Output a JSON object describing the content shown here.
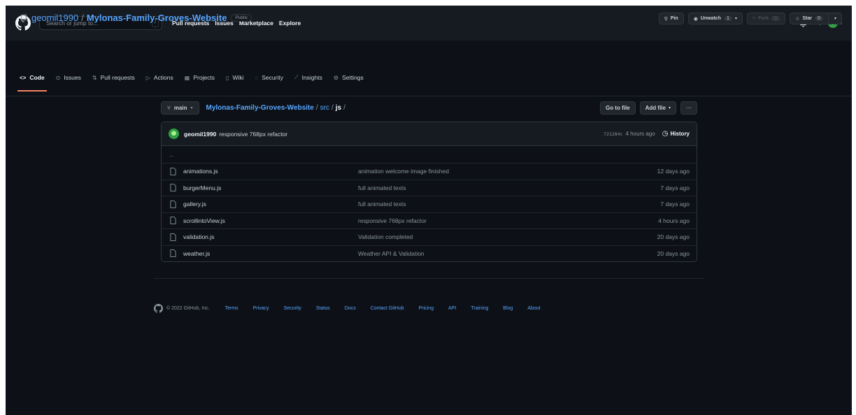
{
  "header": {
    "search_placeholder": "Search or jump to...",
    "search_shortcut": "/",
    "nav": [
      "Pull requests",
      "Issues",
      "Marketplace",
      "Explore"
    ],
    "plus_label": "+",
    "caret": "▾"
  },
  "repo": {
    "owner": "geomil1990",
    "name": "Mylonas-Family-Groves-Website",
    "visibility": "Public",
    "actions": {
      "pin": "Pin",
      "unwatch": "Unwatch",
      "unwatch_count": "1",
      "fork": "Fork",
      "fork_count": "0",
      "star": "Star",
      "star_count": "0"
    },
    "tabs": [
      {
        "label": "Code",
        "icon": "<>"
      },
      {
        "label": "Issues",
        "icon": "⊙"
      },
      {
        "label": "Pull requests",
        "icon": "⇅"
      },
      {
        "label": "Actions",
        "icon": "▷"
      },
      {
        "label": "Projects",
        "icon": "▦"
      },
      {
        "label": "Wiki",
        "icon": "▯"
      },
      {
        "label": "Security",
        "icon": "◌"
      },
      {
        "label": "Insights",
        "icon": "⟋"
      },
      {
        "label": "Settings",
        "icon": "⚙"
      }
    ]
  },
  "path": {
    "branch": "main",
    "root": "Mylonas-Family-Groves-Website",
    "segments": [
      "src"
    ],
    "current": "js",
    "go_to_file": "Go to file",
    "add_file": "Add file",
    "more": "···"
  },
  "commit": {
    "author": "geomil1990",
    "message": "responsive 768px refactor",
    "sha": "721284c",
    "age": "4 hours ago",
    "history": "History"
  },
  "parent_dir": "..",
  "files": [
    {
      "name": "animations.js",
      "message": "animation welcome image finished",
      "age": "12 days ago"
    },
    {
      "name": "burgerMenu.js",
      "message": "full animated texts",
      "age": "7 days ago"
    },
    {
      "name": "gallery.js",
      "message": "full animated texts",
      "age": "7 days ago"
    },
    {
      "name": "scrollintoView.js",
      "message": "responsive 768px refactor",
      "age": "4 hours ago"
    },
    {
      "name": "validation.js",
      "message": "Validation completed",
      "age": "20 days ago"
    },
    {
      "name": "weather.js",
      "message": "Weather API & Validation",
      "age": "20 days ago"
    }
  ],
  "footer": {
    "copyright": "© 2022 GitHub, Inc.",
    "links": [
      "Terms",
      "Privacy",
      "Security",
      "Status",
      "Docs",
      "Contact GitHub",
      "Pricing",
      "API",
      "Training",
      "Blog",
      "About"
    ]
  }
}
